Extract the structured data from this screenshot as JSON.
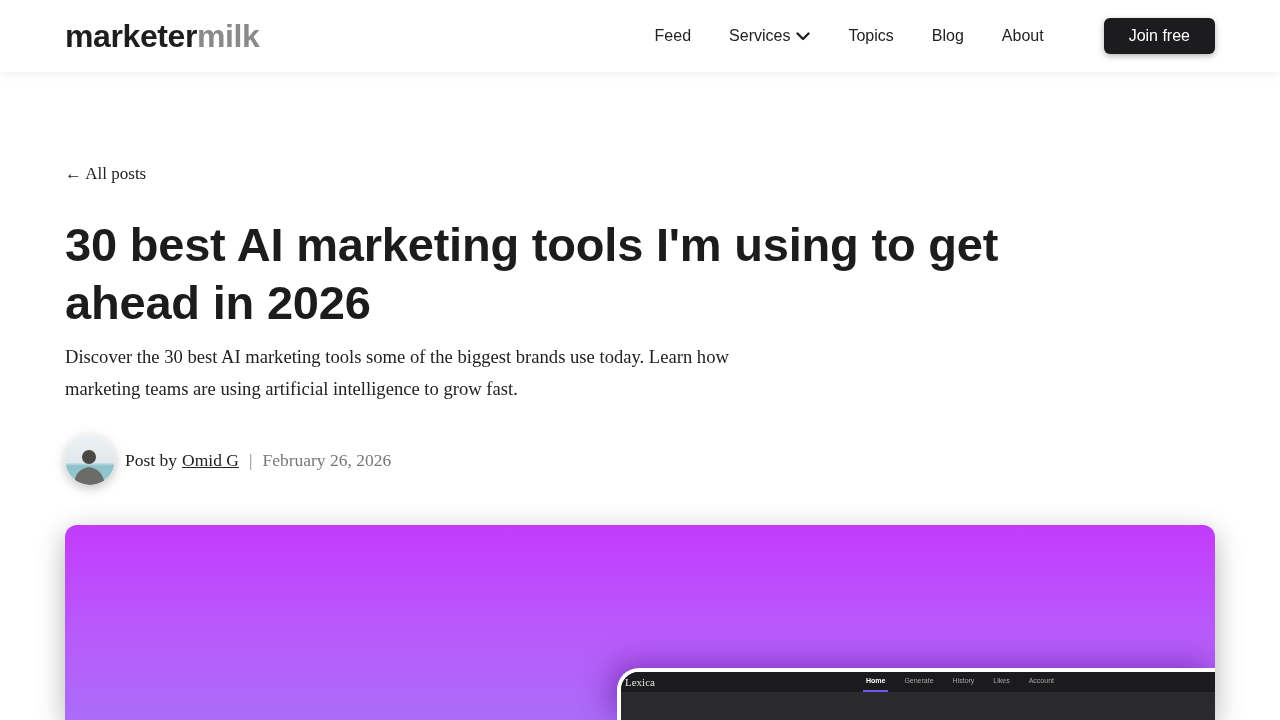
{
  "header": {
    "logo": [
      {
        "text": "marketer",
        "muted": false
      },
      {
        "text": "milk",
        "muted": true
      }
    ],
    "nav": [
      {
        "label": "Feed",
        "kind": "link"
      },
      {
        "label": "Services",
        "kind": "dropdown"
      },
      {
        "label": "Topics",
        "kind": "link"
      },
      {
        "label": "Blog",
        "kind": "link"
      },
      {
        "label": "About",
        "kind": "link"
      }
    ],
    "cta": "Join free"
  },
  "back_link": "← All posts",
  "article": {
    "title": "30 best AI marketing tools I'm using to get ahead in 2026",
    "subtitle": "Discover the 30 best AI marketing tools some of the biggest brands use today. Learn how marketing teams are using artificial intelligence to grow fast.",
    "byline": {
      "prefix": "Post by",
      "author": "Omid G",
      "separator": "|",
      "date": "February 26, 2026"
    }
  },
  "hero_image": {
    "app_screenshot": {
      "logo": "Lexica",
      "nav": [
        {
          "label": "Home",
          "selected": true
        },
        {
          "label": "Generate",
          "selected": false
        },
        {
          "label": "History",
          "selected": false
        },
        {
          "label": "Likes",
          "selected": false
        },
        {
          "label": "Account",
          "selected": false
        }
      ]
    }
  }
}
